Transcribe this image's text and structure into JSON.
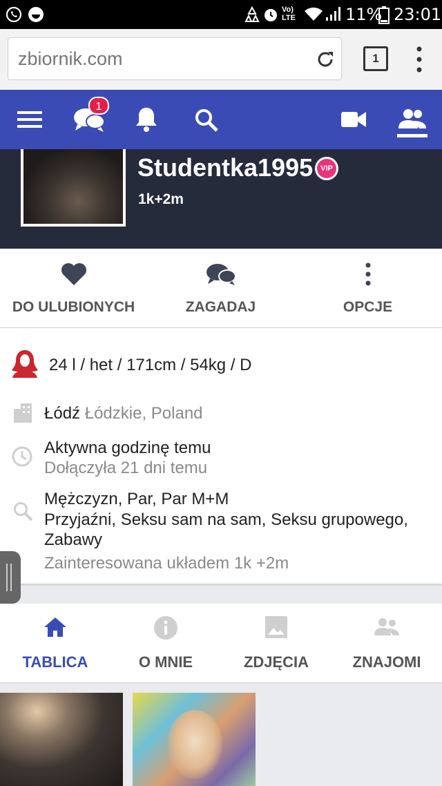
{
  "status": {
    "battery": "11%",
    "time": "23:01",
    "network": "LTE"
  },
  "browser": {
    "url": "zbiornik.com",
    "tab_count": "1"
  },
  "nav": {
    "messages_badge": "1"
  },
  "profile": {
    "username": "Studentka1995",
    "vip_label": "VIP",
    "counts": "1k+2m"
  },
  "actions": [
    {
      "label": "DO ULUBIONYCH",
      "icon": "heart-icon"
    },
    {
      "label": "ZAGADAJ",
      "icon": "chat-icon"
    },
    {
      "label": "OPCJE",
      "icon": "more-vertical-icon"
    }
  ],
  "info": {
    "stats": "24 l / het / 171cm / 54kg / D",
    "city": "Łódź",
    "region": "Łódzkie, Poland",
    "active": "Aktywna godzinę temu",
    "joined": "Dołączyła 21 dni temu",
    "looking_for": "Mężczyzn, Par, Par M+M",
    "interests": "Przyjaźni, Seksu sam na sam, Seksu grupowego, Zabawy",
    "arrangement": "Zainteresowana układem 1k +2m"
  },
  "tabs": [
    {
      "label": "TABLICA",
      "icon": "home-icon",
      "active": true
    },
    {
      "label": "O MNIE",
      "icon": "info-icon",
      "active": false
    },
    {
      "label": "ZDJĘCIA",
      "icon": "image-icon",
      "active": false
    },
    {
      "label": "ZNAJOMI",
      "icon": "friends-icon",
      "active": false
    }
  ],
  "colors": {
    "accent": "#3b4bb6",
    "header_bg": "#262b3c",
    "badge": "#e0204a",
    "vip": "#e8347a"
  }
}
